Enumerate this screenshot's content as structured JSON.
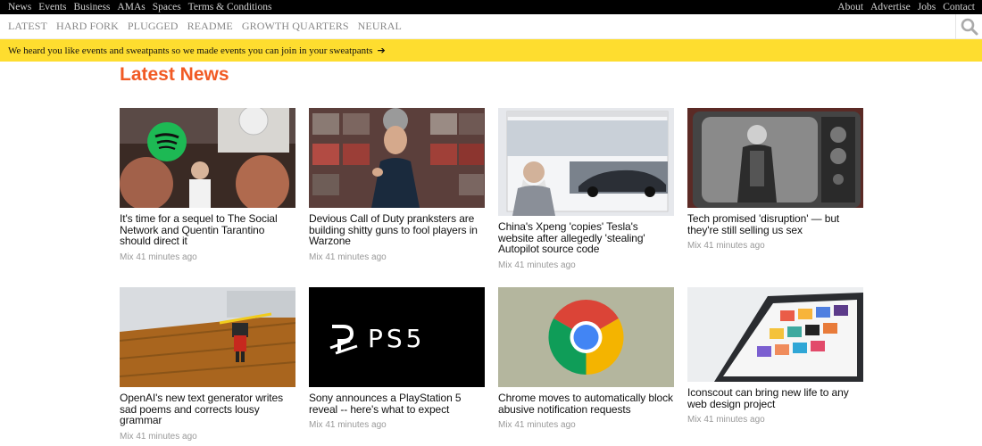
{
  "topnav": {
    "left": [
      "News",
      "Events",
      "Business",
      "AMAs",
      "Spaces",
      "Terms & Conditions"
    ],
    "right": [
      "About",
      "Advertise",
      "Jobs",
      "Contact"
    ]
  },
  "channels": [
    "LATEST",
    "HARD FORK",
    "PLUGGED",
    "README",
    "GROWTH QUARTERS",
    "NEURAL"
  ],
  "banner": {
    "text": "We heard you like events and sweatpants so we made events you can join in your sweatpants",
    "arrow": "➔"
  },
  "heading": "Latest News",
  "articles": [
    {
      "title": "It's time for a sequel to The Social Network and Quentin Tarantino should direct it",
      "meta": "Mix 41 minutes ago",
      "thumb": "spotify-scene"
    },
    {
      "title": "Devious Call of Duty pranksters are building shitty guns to fool players in Warzone",
      "meta": "Mix 41 minutes ago",
      "thumb": "keynote-scene"
    },
    {
      "title": "China's Xpeng 'copies' Tesla's website after allegedly 'stealing' Autopilot source code",
      "meta": "Mix 41 minutes ago",
      "thumb": "website-scene"
    },
    {
      "title": "Tech promised 'disruption' — but they're still selling us sex",
      "meta": "Mix 41 minutes ago",
      "thumb": "tv-scene"
    },
    {
      "title": "OpenAI's new text generator writes sad poems and corrects lousy grammar",
      "meta": "Mix 41 minutes ago",
      "thumb": "robot-scene"
    },
    {
      "title": "Sony announces a PlayStation 5 reveal -- here's what to expect",
      "meta": "Mix 41 minutes ago",
      "thumb": "ps5-logo"
    },
    {
      "title": "Chrome moves to automatically block abusive notification requests",
      "meta": "Mix 41 minutes ago",
      "thumb": "chrome-logo"
    },
    {
      "title": "Iconscout can bring new life to any web design project",
      "meta": "Mix 41 minutes ago",
      "thumb": "tablet-scene"
    }
  ],
  "thumb_labels": {
    "ps5": "PS5"
  },
  "colors": {
    "accent": "#f15a24",
    "banner": "#fedd2f",
    "topbar": "#000000"
  }
}
